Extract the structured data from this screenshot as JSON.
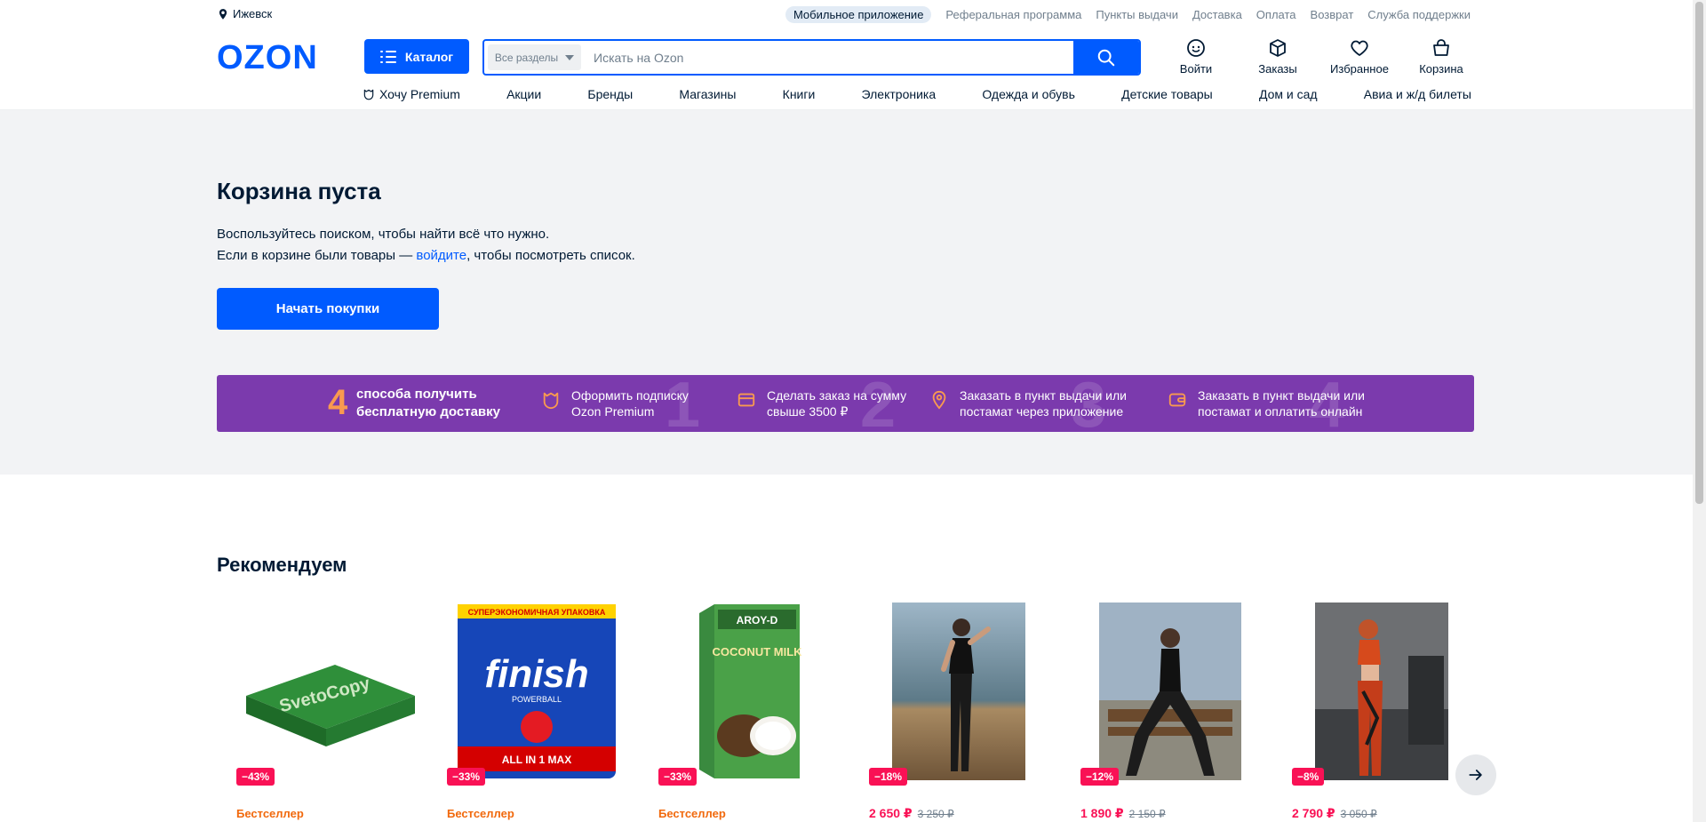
{
  "topbar": {
    "city": "Ижевск",
    "links": [
      "Мобильное приложение",
      "Реферальная программа",
      "Пункты выдачи",
      "Доставка",
      "Оплата",
      "Возврат",
      "Служба поддержки"
    ]
  },
  "header": {
    "logo": "OZON",
    "catalog_label": "Каталог",
    "search": {
      "category": "Все разделы",
      "placeholder": "Искать на Ozon"
    },
    "actions": [
      "Войти",
      "Заказы",
      "Избранное",
      "Корзина"
    ]
  },
  "nav": [
    "Хочу Premium",
    "Акции",
    "Бренды",
    "Магазины",
    "Книги",
    "Электроника",
    "Одежда и обувь",
    "Детские товары",
    "Дом и сад",
    "Авиа и ж/д билеты"
  ],
  "cart": {
    "title": "Корзина пуста",
    "line1": "Воспользуйтесь поиском, чтобы найти всё что нужно.",
    "line2_pre": "Если в корзине были товары — ",
    "line2_link": "войдите",
    "line2_post": ", чтобы посмотреть список.",
    "start_button": "Начать покупки"
  },
  "banner": {
    "count": "4",
    "lead1": "способа получить",
    "lead2": "бесплатную доставку",
    "items": [
      {
        "num": "1",
        "line1": "Оформить подписку",
        "line2": "Ozon Premium"
      },
      {
        "num": "2",
        "line1": "Сделать заказ на сумму",
        "line2": "свыше 3500 ₽"
      },
      {
        "num": "3",
        "line1": "Заказать в пункт выдачи или",
        "line2": "постамат через приложение"
      },
      {
        "num": "4",
        "line1": "Заказать в пункт выдачи или",
        "line2": "постамат и оплатить онлайн"
      }
    ]
  },
  "recommend": {
    "title": "Рекомендуем",
    "products": [
      {
        "discount": "−43%",
        "label": "Бестселлер"
      },
      {
        "discount": "−33%",
        "label": "Бестселлер"
      },
      {
        "discount": "−33%",
        "label": "Бестселлер"
      },
      {
        "discount": "−18%",
        "price": "2 650  ₽",
        "old": "3 250 ₽"
      },
      {
        "discount": "−12%",
        "price": "1 890  ₽",
        "old": "2 150 ₽"
      },
      {
        "discount": "−8%",
        "price": "2 790  ₽",
        "old": "3 050 ₽"
      }
    ]
  },
  "colors": {
    "accent": "#005bff",
    "banner": "#7b3aad",
    "discount": "#f91155",
    "bestseller": "#f1690d"
  },
  "product_images": {
    "p1_text": "SvetoCopy",
    "p2_top": "СУПЕРЭКОНОМИЧНАЯ УПАКОВКА",
    "p2_brand": "finish",
    "p2_sub": "POWERBALL",
    "p2_bottom": "ALL IN 1 MAX",
    "p3_brand": "AROY-D",
    "p3_name": "COCONUT MILK"
  }
}
